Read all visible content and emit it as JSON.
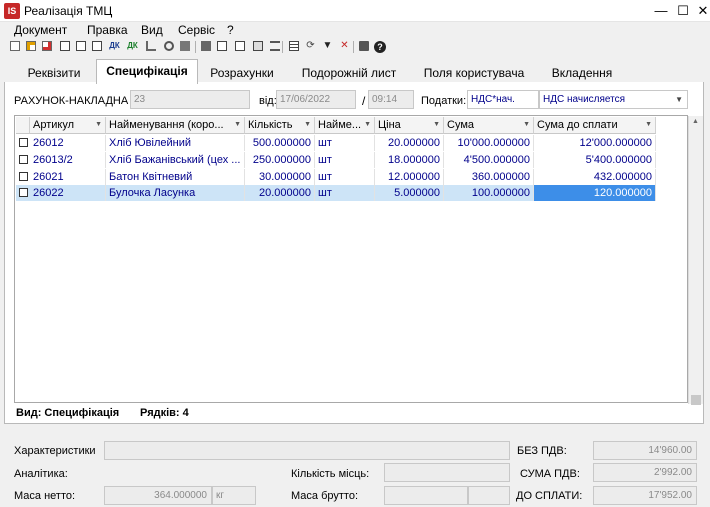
{
  "window": {
    "title": "Реалізація ТМЦ",
    "app_badge": "IS"
  },
  "menu": [
    "Документ",
    "Правка",
    "Вид",
    "Сервіс",
    "?"
  ],
  "toolbar_icons": [
    "new-icon",
    "add-icon",
    "delete-icon",
    "copy-icon",
    "paste-icon",
    "edit-icon",
    "dk-icon",
    "dk2-icon",
    "tree-icon",
    "link-icon",
    "card-icon",
    "block-icon",
    "list-icon",
    "list2-icon",
    "move-icon",
    "org-icon",
    "table-icon",
    "refresh-icon",
    "filter-icon",
    "filter-clear-icon",
    "print-icon",
    "help-icon"
  ],
  "tabs": [
    "Реквізити",
    "Специфікація",
    "Розрахунки",
    "Подорожній лист",
    "Поля користувача",
    "Вкладення"
  ],
  "active_tab": "Специфікація",
  "header": {
    "doc_label": "РАХУНОК-НАКЛАДНА №:",
    "doc_number": "23",
    "date_label": "від:",
    "date": "17/06/2022",
    "slash": "/",
    "time": "09:14",
    "taxes_label": "Податки:",
    "tax_code": "НДС*нач.",
    "tax_name": "НДС начисляется"
  },
  "grid": {
    "columns": [
      "Артикул",
      "Найменування (коро...",
      "Кількість",
      "Наймe...",
      "Ціна",
      "Сума",
      "Сума до сплати"
    ],
    "rows": [
      {
        "article": "26012",
        "name": "Хліб Ювілейний",
        "qty": "500.000000",
        "unit": "шт",
        "price": "20.000000",
        "sum": "10'000.000000",
        "total": "12'000.000000"
      },
      {
        "article": "26013/2",
        "name": "Хліб Бажанівський (цех ...",
        "qty": "250.000000",
        "unit": "шт",
        "price": "18.000000",
        "sum": "4'500.000000",
        "total": "5'400.000000"
      },
      {
        "article": "26021",
        "name": "Батон Квітневий",
        "qty": "30.000000",
        "unit": "шт",
        "price": "12.000000",
        "sum": "360.000000",
        "total": "432.000000"
      },
      {
        "article": "26022",
        "name": "Булочка Ласунка",
        "qty": "20.000000",
        "unit": "шт",
        "price": "5.000000",
        "sum": "100.000000",
        "total": "120.000000"
      }
    ],
    "footer_view": "Вид: Специфікація",
    "footer_rows": "Рядків: 4"
  },
  "bottom": {
    "characteristics_label": "Характеристики",
    "characteristics_value": "",
    "analytics_label": "Аналітика:",
    "places_label": "Кількість місць:",
    "places_value": "",
    "net_mass_label": "Маса нетто:",
    "net_mass_value": "364.000000",
    "net_mass_unit": "кг",
    "gross_mass_label": "Маса брутто:",
    "gross_mass_value": "",
    "no_vat_label": "БЕЗ ПДВ:",
    "no_vat_value": "14'960.00",
    "vat_label": "СУМА ПДВ:",
    "vat_value": "2'992.00",
    "to_pay_label": "ДО СПЛАТИ:",
    "to_pay_value": "17'952.00"
  },
  "colors": {
    "accent": "#3d8ee8",
    "selected_row": "#cde4f7",
    "text_blue": "#00008b",
    "app_red": "#c62828"
  }
}
